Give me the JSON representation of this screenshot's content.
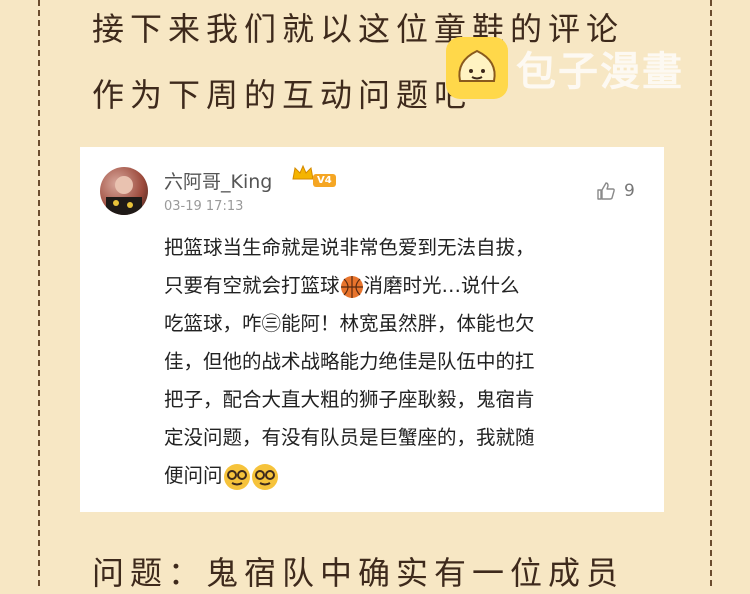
{
  "heading": {
    "line1": "接下来我们就以这位童鞋的评论",
    "line2": "作为下周的互动问题吧~",
    "line3": "问题：鬼宿队中确实有一位成员"
  },
  "watermark": {
    "text": "包子漫畫"
  },
  "comment": {
    "username": "六阿哥_King",
    "vip_level": "V4",
    "timestamp": "03-19 17:13",
    "likes": "9",
    "body_lines": [
      "把篮球当生命就是说非常色爱到无法自拔，",
      "只要有空就会打篮球",
      "消磨时光…说什么",
      "吃篮球，咋㊂能阿！林宽虽然胖，体能也欠",
      "佳，但他的战术战略能力绝佳是队伍中的扛",
      "把子，配合大直大粗的狮子座耿毅，鬼宿肯",
      "定没问题，有没有队员是巨蟹座的，我就随",
      "便问问"
    ]
  },
  "colors": {
    "background": "#f7e7c4",
    "border": "#6b4c2e",
    "badge": "#f5a623"
  }
}
